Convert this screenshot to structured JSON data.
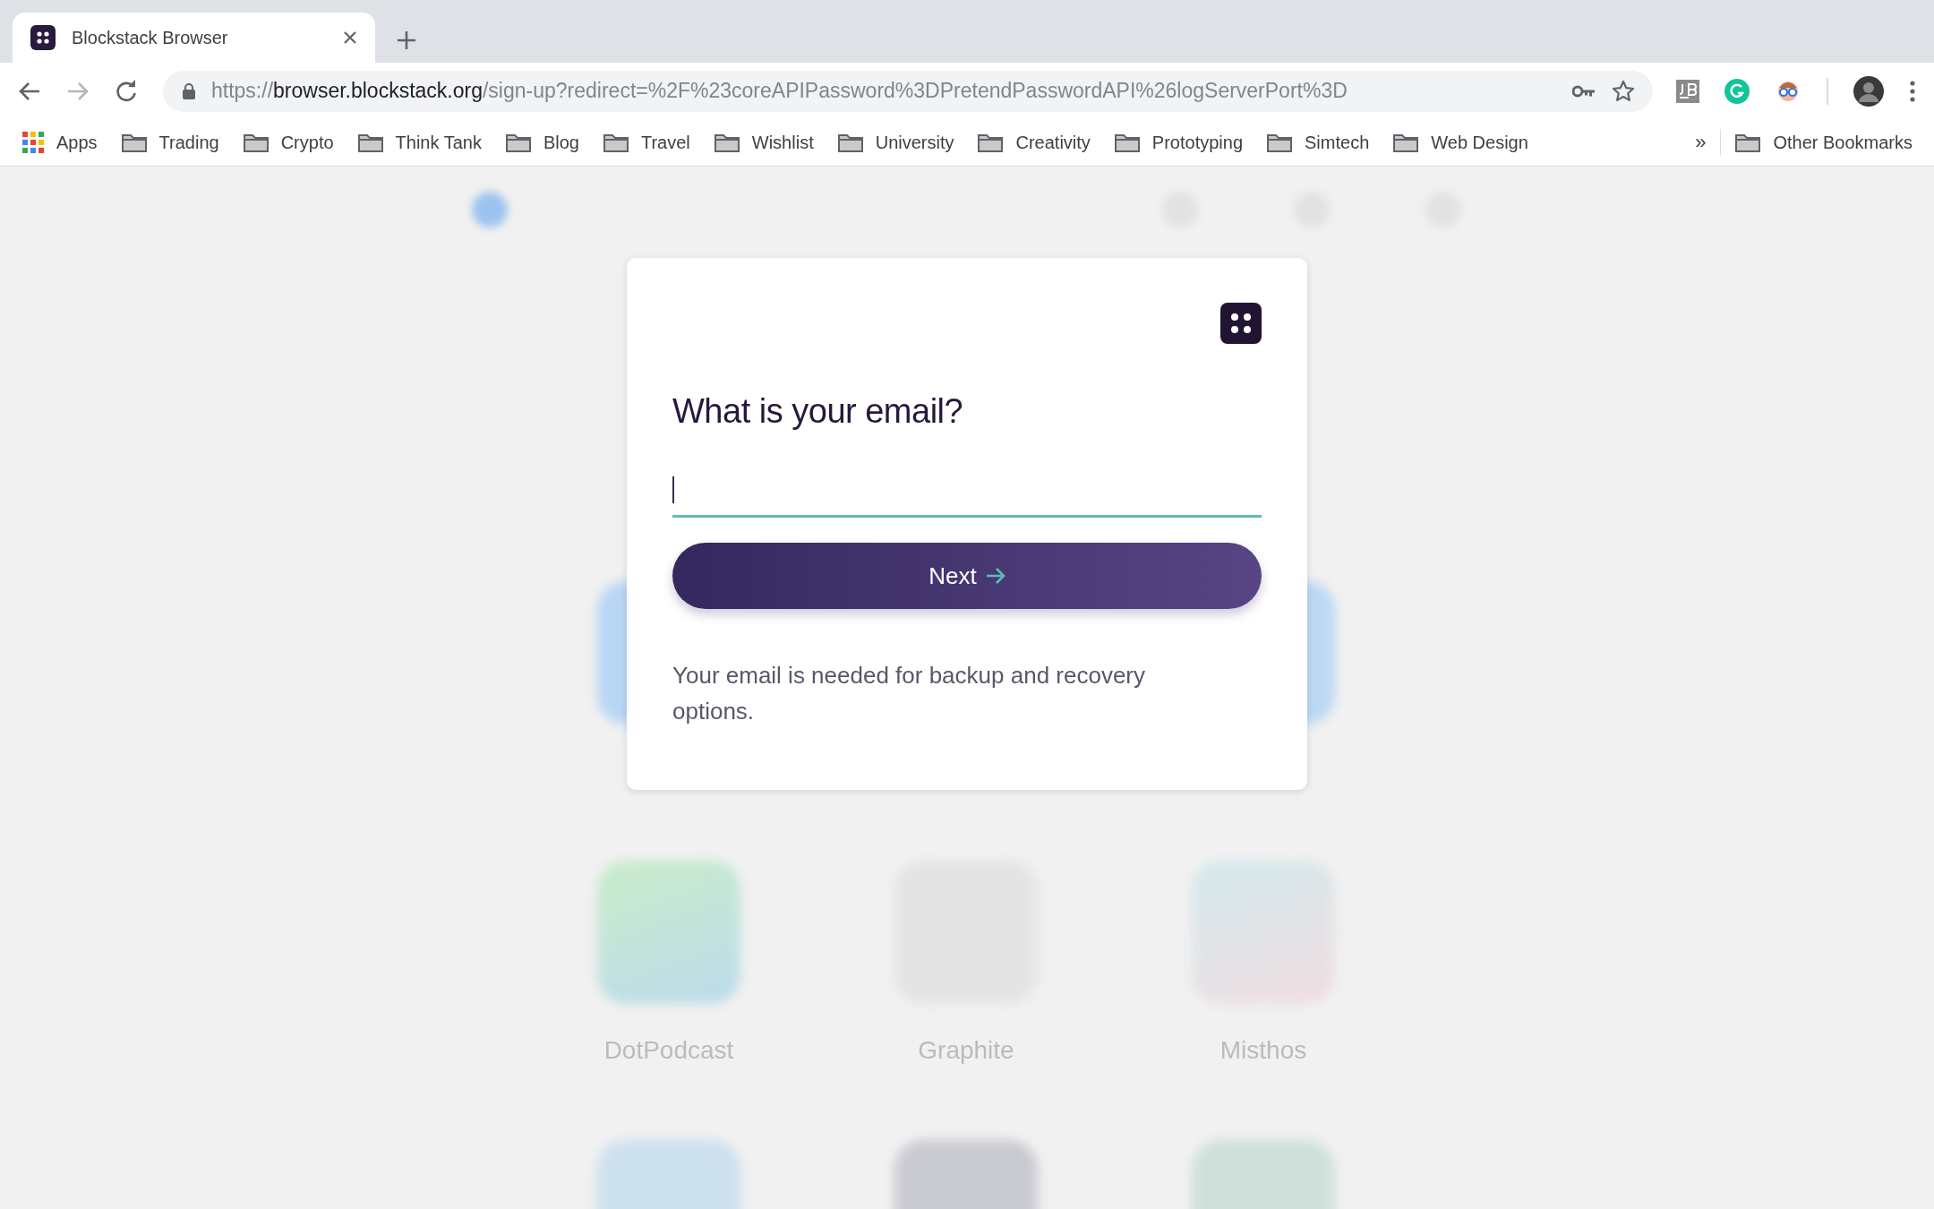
{
  "tabs": [
    {
      "title": "Blockstack Browser",
      "selected": true
    }
  ],
  "address_bar": {
    "scheme": "https://",
    "host": "browser.blockstack.org",
    "path": "/sign-up?redirect=%2F%23coreAPIPassword%3DPretendPasswordAPI%26logServerPort%3D"
  },
  "bookmarks": [
    {
      "label": "Apps",
      "kind": "apps"
    },
    {
      "label": "Trading",
      "kind": "folder"
    },
    {
      "label": "Crypto",
      "kind": "folder"
    },
    {
      "label": "Think Tank",
      "kind": "folder"
    },
    {
      "label": "Blog",
      "kind": "folder"
    },
    {
      "label": "Travel",
      "kind": "folder"
    },
    {
      "label": "Wishlist",
      "kind": "folder"
    },
    {
      "label": "University",
      "kind": "folder"
    },
    {
      "label": "Creativity",
      "kind": "folder"
    },
    {
      "label": "Prototyping",
      "kind": "folder"
    },
    {
      "label": "Simtech",
      "kind": "folder"
    },
    {
      "label": "Web Design",
      "kind": "folder"
    }
  ],
  "bookmarks_overflow": "»",
  "other_bookmarks": "Other Bookmarks",
  "nav": [
    {
      "selected": true
    },
    {
      "selected": false
    },
    {
      "selected": false
    },
    {
      "selected": false
    }
  ],
  "dialog": {
    "heading": "What is your email?",
    "email_field": {
      "focused": true
    },
    "button": "Next",
    "note": "Your email is needed for backup and recovery options."
  },
  "apps": [
    {
      "name": "DotPodcast"
    },
    {
      "name": "Graphite"
    },
    {
      "name": "Misthos"
    }
  ]
}
